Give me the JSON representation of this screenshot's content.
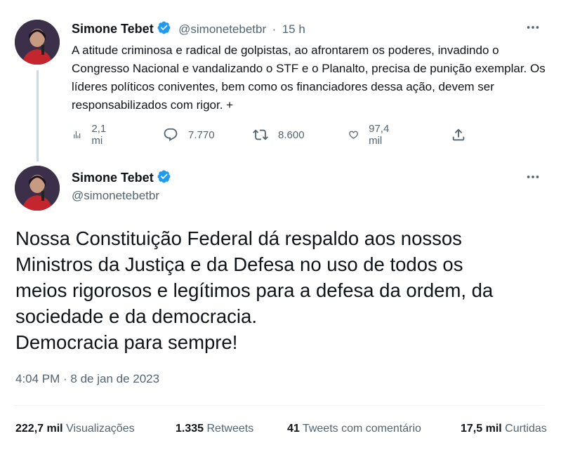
{
  "tweet1": {
    "author_name": "Simone Tebet",
    "author_handle": "@simonetebetbr",
    "separator": "·",
    "time_ago": "15 h",
    "text": "A atitude criminosa e radical de golpistas, ao afrontarem os poderes, invadindo o Congresso Nacional e vandalizando o STF e o Planalto, precisa de punição exemplar. Os líderes políticos coniventes, bem como os financiadores dessa ação, devem ser responsabilizados com rigor. +",
    "more_icon": "more-horizontal-icon",
    "actions": {
      "views": "2,1 mi",
      "replies": "7.770",
      "retweets": "8.600",
      "likes": "97,4 mil"
    }
  },
  "tweet2": {
    "author_name": "Simone Tebet",
    "author_handle": "@simonetebetbr",
    "more_icon": "more-horizontal-icon",
    "lines": [
      "Nossa Constituição Federal dá respaldo aos nossos",
      "Ministros da Justiça e da Defesa no uso de todos os",
      "meios rigorosos e legítimos para a defesa da ordem, da",
      "sociedade e da democracia.",
      "Democracia para sempre!"
    ],
    "timestamp": "4:04 PM · 8 de jan de 2023",
    "stats": {
      "views_value": "222,7 mil",
      "views_label": "Visualizações",
      "retweets_value": "1.335",
      "retweets_label": "Retweets",
      "quotes_value": "41",
      "quotes_label": "Tweets com comentário",
      "likes_value": "17,5 mil",
      "likes_label": "Curtidas"
    }
  },
  "colors": {
    "verified": "#1d9bf0",
    "text_primary": "#0f1419",
    "text_secondary": "#536471",
    "divider": "#eff3f4"
  }
}
